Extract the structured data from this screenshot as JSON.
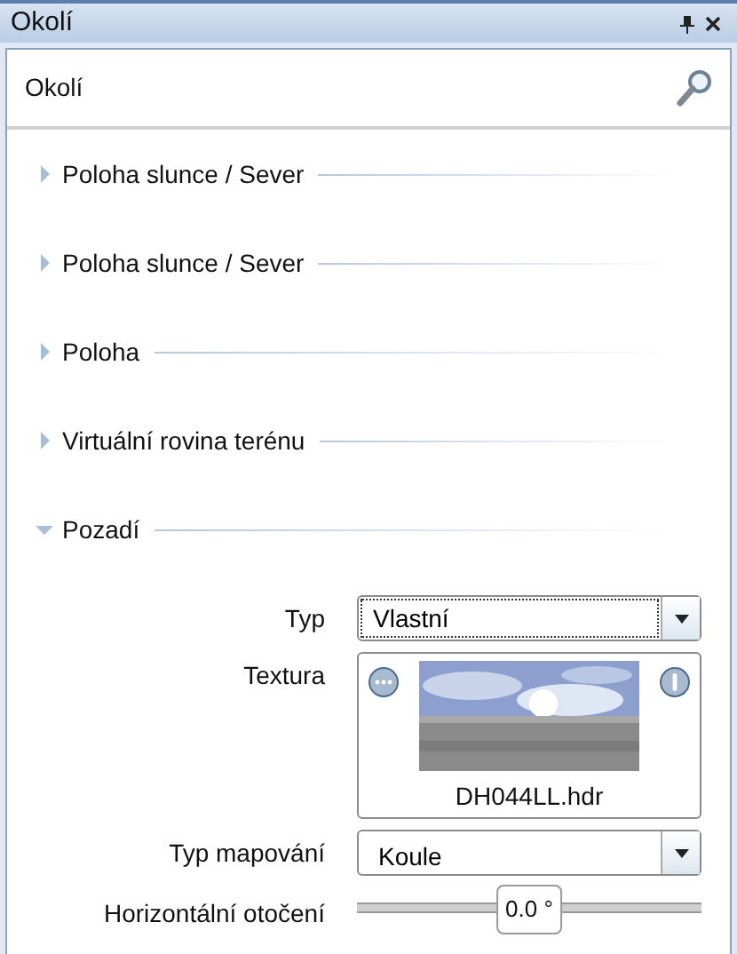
{
  "window": {
    "title": "Okolí"
  },
  "panel": {
    "title": "Okolí"
  },
  "sections": [
    {
      "title": "Poloha slunce / Sever",
      "expanded": false
    },
    {
      "title": "Poloha slunce / Sever",
      "expanded": false
    },
    {
      "title": "Poloha",
      "expanded": false
    },
    {
      "title": "Virtuální rovina terénu",
      "expanded": false
    },
    {
      "title": "Pozadí",
      "expanded": true
    }
  ],
  "fields": [
    {
      "kind": "dropdown",
      "label": "Typ",
      "value": "Vlastní",
      "focused": true
    },
    {
      "kind": "texture",
      "label": "Textura",
      "file": "DH044LL.hdr"
    },
    {
      "kind": "dropdown",
      "label": "Typ mapování",
      "value": "Koule",
      "focused": false
    },
    {
      "kind": "slider",
      "label": "Horizontální otočení",
      "reading": "0.0 °",
      "level": 0.5
    }
  ]
}
